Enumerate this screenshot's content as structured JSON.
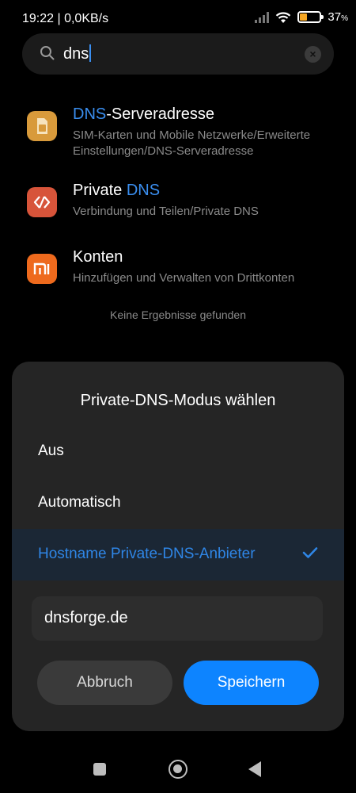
{
  "status_bar": {
    "time_speed": "19:22 | 0,0KB/s",
    "battery_level": 37,
    "battery_percent": "37",
    "battery_suffix": "%"
  },
  "search": {
    "query": "dns",
    "icon": "search-icon",
    "clear_icon": "close-icon"
  },
  "results": [
    {
      "title_highlight": "DNS",
      "title_rest": "-Serveradresse",
      "subtitle": "SIM-Karten und Mobile Netzwerke/Erweiterte Einstellungen/DNS-Serveradresse",
      "icon": "sim-card-icon",
      "icon_color": "#d89a3b"
    },
    {
      "title_plain": "Private ",
      "title_highlight": "DNS",
      "subtitle": "Verbindung und Teilen/Private DNS",
      "icon": "connection-share-icon",
      "icon_color": "#d7543a"
    },
    {
      "title": "Konten",
      "subtitle": "Hinzufügen und Verwalten von Drittkonten",
      "icon": "mi-logo-icon",
      "icon_color": "#ee6a1d"
    }
  ],
  "no_results": "Keine Ergebnisse gefunden",
  "dialog": {
    "title": "Private-DNS-Modus wählen",
    "options": [
      {
        "label": "Aus",
        "selected": false
      },
      {
        "label": "Automatisch",
        "selected": false
      },
      {
        "label": "Hostname Private-DNS-Anbieter",
        "selected": true
      }
    ],
    "hostname_value": "dnsforge.de",
    "cancel_label": "Abbruch",
    "save_label": "Speichern",
    "accent_color": "#0d84ff"
  },
  "nav": {
    "recents_icon": "square-recents-icon",
    "home_icon": "home-circle-icon",
    "back_icon": "back-triangle-icon"
  }
}
